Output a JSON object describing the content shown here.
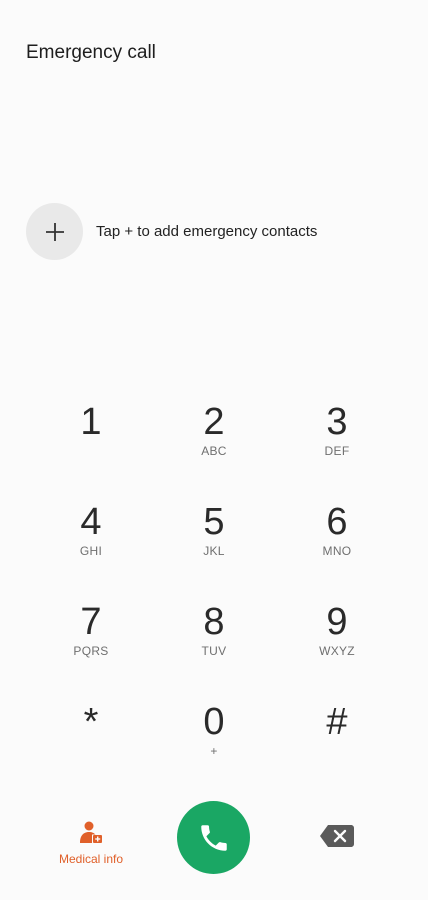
{
  "header": {
    "title": "Emergency call"
  },
  "contacts": {
    "hint": "Tap + to add emergency contacts",
    "add_icon": "plus-icon"
  },
  "keypad": {
    "rows": [
      [
        {
          "digit": "1",
          "letters": ""
        },
        {
          "digit": "2",
          "letters": "ABC"
        },
        {
          "digit": "3",
          "letters": "DEF"
        }
      ],
      [
        {
          "digit": "4",
          "letters": "GHI"
        },
        {
          "digit": "5",
          "letters": "JKL"
        },
        {
          "digit": "6",
          "letters": "MNO"
        }
      ],
      [
        {
          "digit": "7",
          "letters": "PQRS"
        },
        {
          "digit": "8",
          "letters": "TUV"
        },
        {
          "digit": "9",
          "letters": "WXYZ"
        }
      ],
      [
        {
          "digit": "*",
          "letters": ""
        },
        {
          "digit": "0",
          "letters": "+"
        },
        {
          "digit": "#",
          "letters": ""
        }
      ]
    ]
  },
  "bottom": {
    "medical_label": "Medical info",
    "medical_icon": "medical-person-icon",
    "call_icon": "phone-icon",
    "backspace_icon": "backspace-icon"
  },
  "colors": {
    "call_green": "#1aa764",
    "medical_orange": "#e0602a",
    "add_bg": "#e9e9e9",
    "background": "#fbfbfb"
  }
}
